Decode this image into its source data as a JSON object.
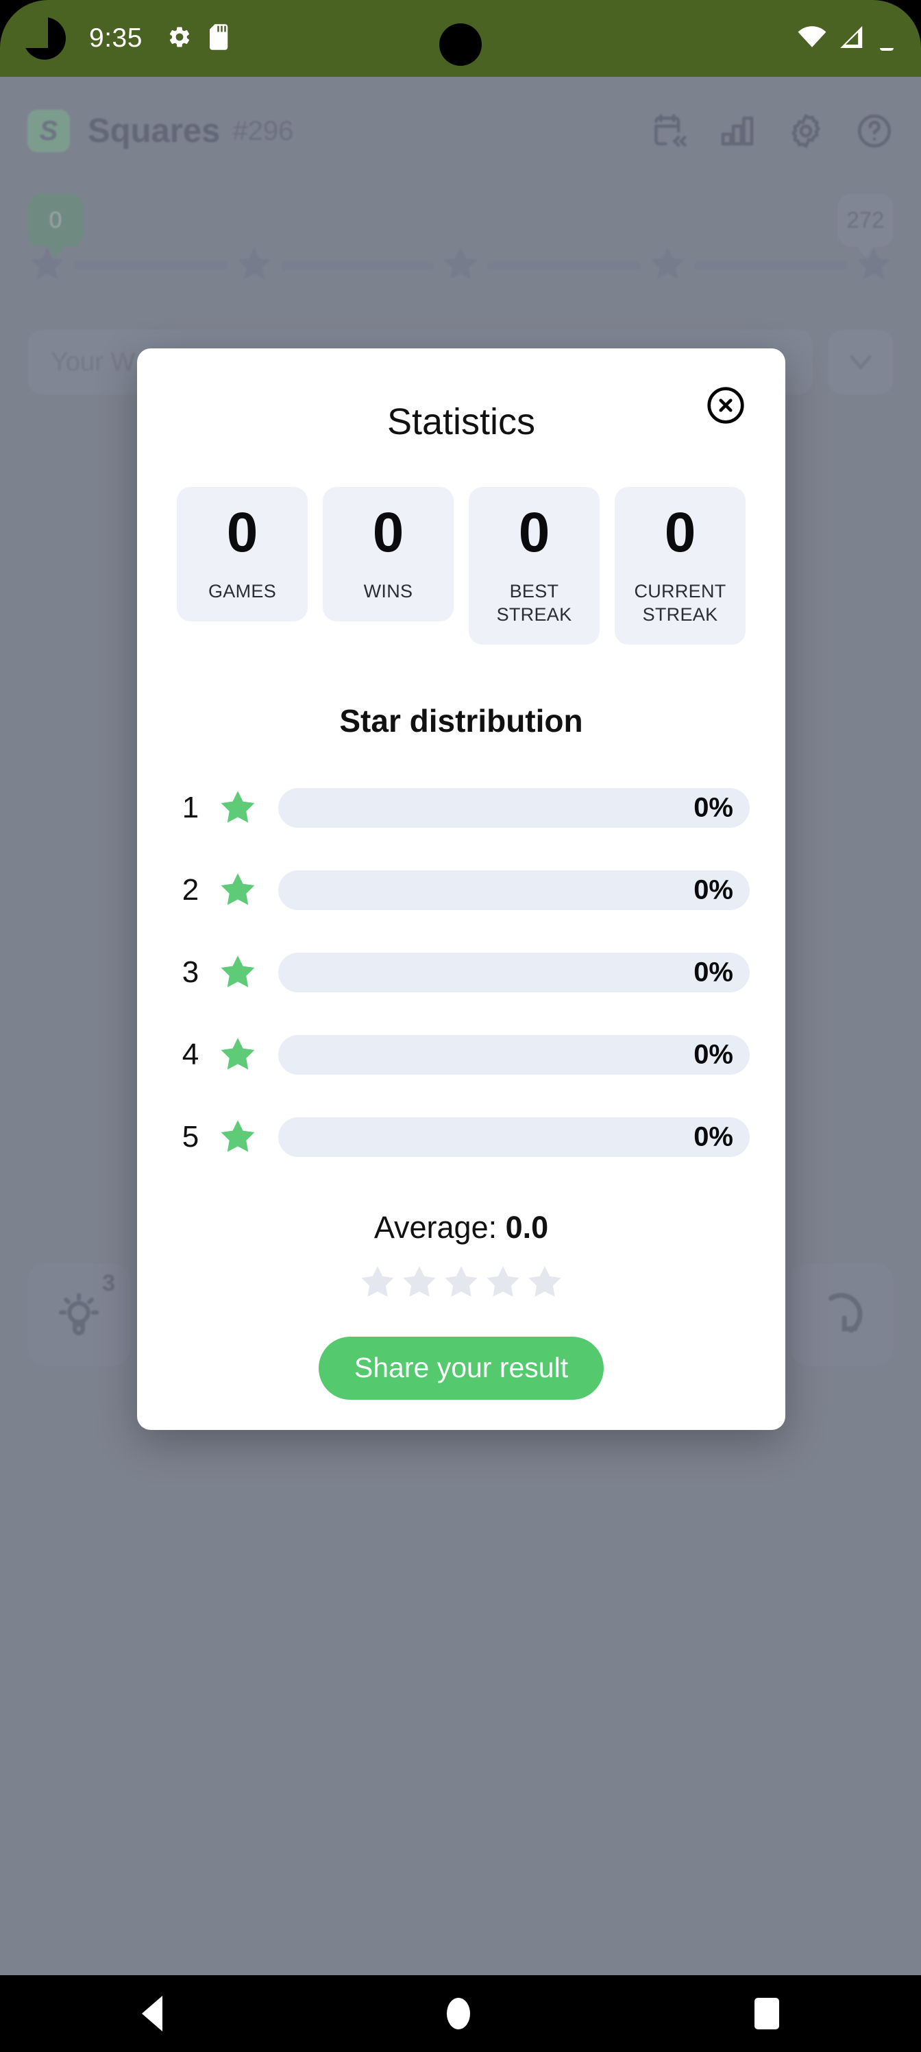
{
  "status_bar": {
    "time": "9:35",
    "icons": [
      "gear-icon",
      "sd-card-icon",
      "wifi-icon",
      "cellular-signal-icon",
      "battery-icon"
    ]
  },
  "app": {
    "logo_letter": "S",
    "title": "Squares",
    "puzzle_number": "#296",
    "header_icons": [
      "calendar-rewind-icon",
      "bar-chart-icon",
      "gear-icon",
      "help-circle-icon"
    ],
    "progress": {
      "left_badge": "0",
      "right_badge": "272",
      "star_count": 5
    },
    "selector": {
      "label": "Your W",
      "caret": "chevron-down-icon"
    },
    "tools": {
      "hint_label": "hint-bulb-icon",
      "hint_count": "3",
      "restart_label": "restart-icon"
    }
  },
  "modal": {
    "title": "Statistics",
    "close_label": "close-icon",
    "stats": [
      {
        "value": "0",
        "label": "GAMES"
      },
      {
        "value": "0",
        "label": "WINS"
      },
      {
        "value": "0",
        "label": "BEST STREAK"
      },
      {
        "value": "0",
        "label": "CURRENT STREAK"
      }
    ],
    "distribution_title": "Star distribution",
    "distribution": [
      {
        "stars": "1",
        "percent_label": "0%",
        "percent": 0
      },
      {
        "stars": "2",
        "percent_label": "0%",
        "percent": 0
      },
      {
        "stars": "3",
        "percent_label": "0%",
        "percent": 0
      },
      {
        "stars": "4",
        "percent_label": "0%",
        "percent": 0
      },
      {
        "stars": "5",
        "percent_label": "0%",
        "percent": 0
      }
    ],
    "average_prefix": "Average: ",
    "average_value": "0.0",
    "average_star_count": 5,
    "average_star_filled": 0,
    "share_label": "Share your result"
  },
  "nav_bar": {
    "items": [
      "back-button",
      "home-button",
      "recents-button"
    ]
  },
  "colors": {
    "status_bar_bg": "#4a6322",
    "app_bg": "#9094a1",
    "accent_green": "#54c96e",
    "star_green": "#5ecb78",
    "bar_track": "#e9edf5",
    "stat_card_bg": "#eef1f8"
  }
}
